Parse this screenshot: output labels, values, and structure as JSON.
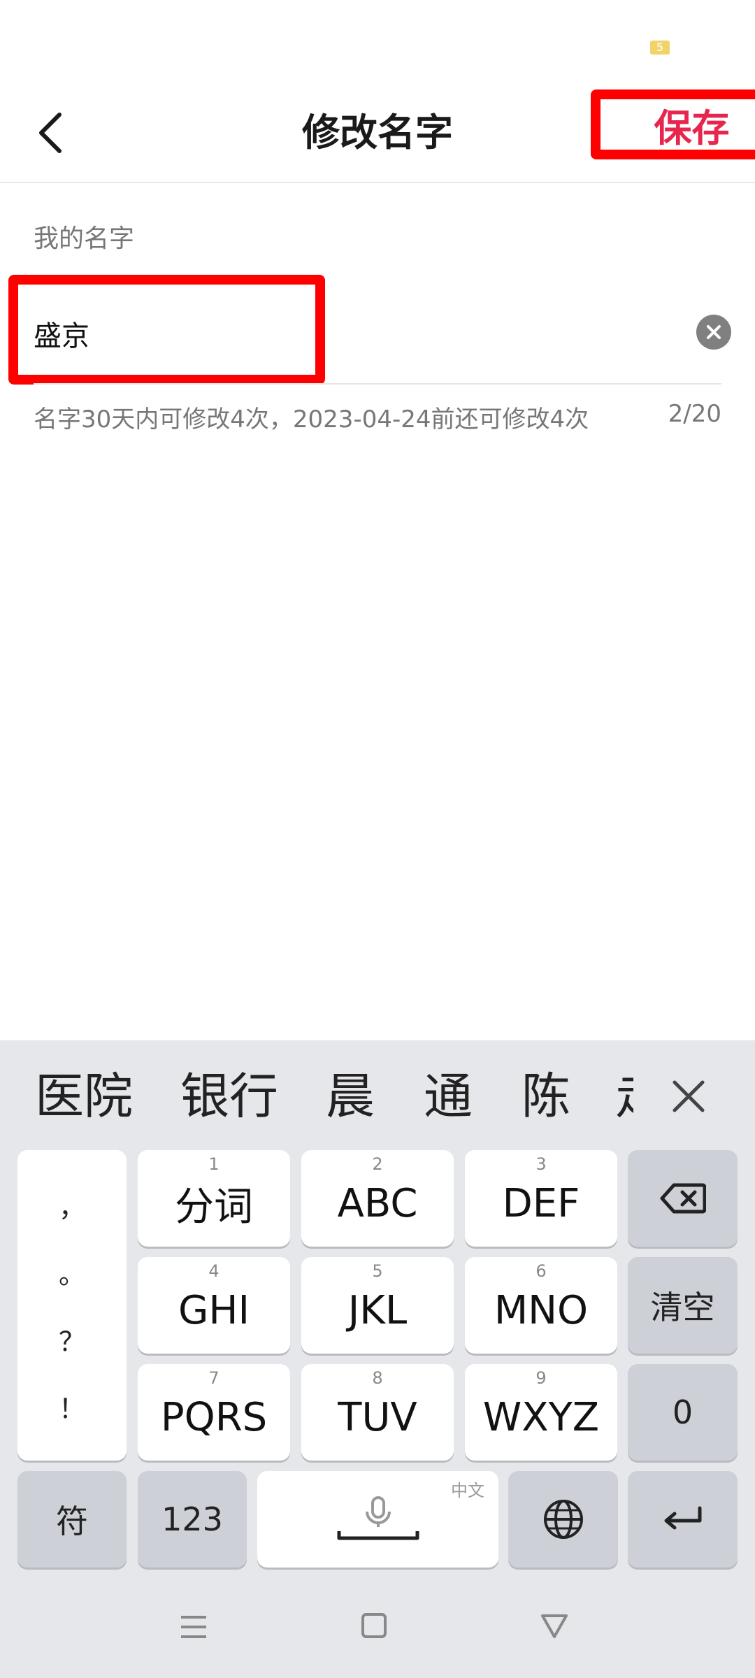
{
  "status_bar": {
    "battery_level": "5"
  },
  "header": {
    "title": "修改名字",
    "save_label": "保存"
  },
  "form": {
    "label": "我的名字",
    "name_value": "盛京",
    "hint": "名字30天内可修改4次，2023-04-24前还可修改4次",
    "counter": "2/20"
  },
  "keyboard": {
    "candidates": [
      "医院",
      "银行",
      "晨",
      "通",
      "陈",
      "走"
    ],
    "punctuation": [
      "，",
      "。",
      "？",
      "！"
    ],
    "keys": [
      {
        "num": "1",
        "label": "分词"
      },
      {
        "num": "2",
        "label": "ABC"
      },
      {
        "num": "3",
        "label": "DEF"
      },
      {
        "num": "4",
        "label": "GHI"
      },
      {
        "num": "5",
        "label": "JKL"
      },
      {
        "num": "6",
        "label": "MNO"
      },
      {
        "num": "7",
        "label": "PQRS"
      },
      {
        "num": "8",
        "label": "TUV"
      },
      {
        "num": "9",
        "label": "WXYZ"
      }
    ],
    "clear_label": "清空",
    "zero_label": "0",
    "symbols_label": "符",
    "numbers_label": "123",
    "space_lang": "中文"
  },
  "icons": {
    "back": "chevron-left-icon",
    "clear": "close-circle-icon",
    "backspace": "backspace-icon",
    "mic": "microphone-icon",
    "globe": "globe-icon",
    "enter": "enter-icon",
    "menu": "menu-icon",
    "home": "square-icon",
    "back_nav": "triangle-down-icon"
  },
  "colors": {
    "accent": "#e8264d",
    "highlight": "#ff0000",
    "muted": "#777777"
  }
}
